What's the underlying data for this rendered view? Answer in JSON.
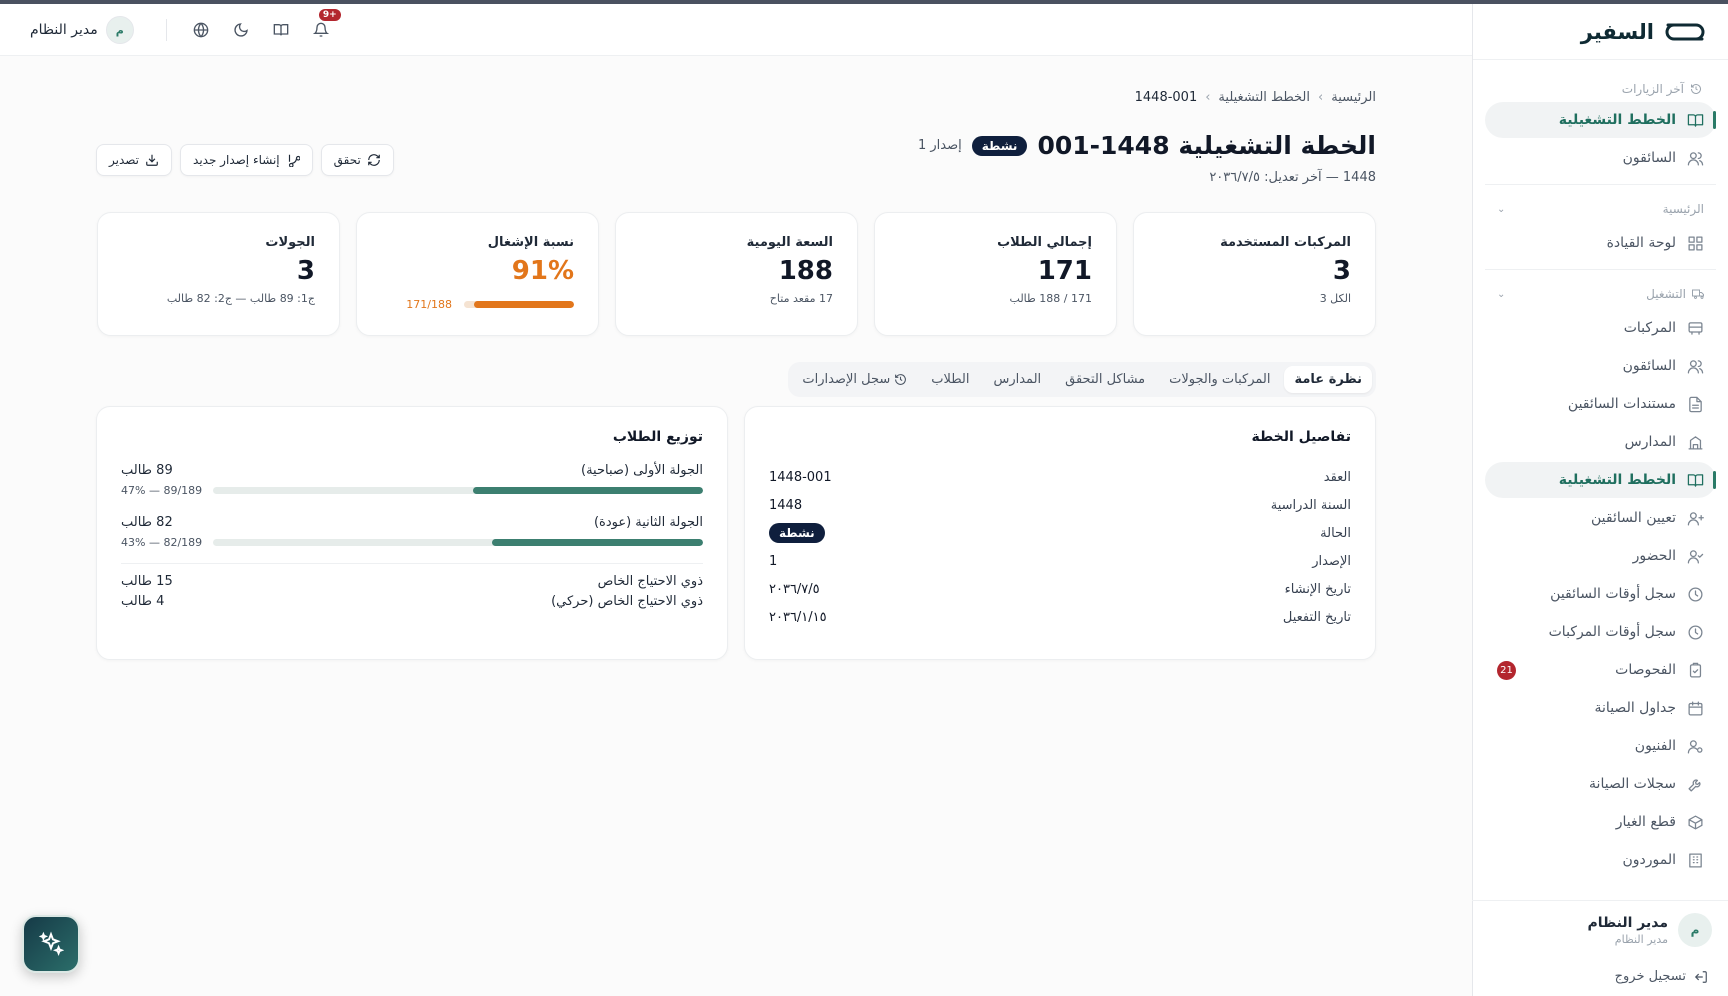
{
  "app": {
    "brand": "السفير"
  },
  "topbar": {
    "user_name": "مدير النظام",
    "user_initial": "م",
    "notif_count": "9+"
  },
  "sidebar": {
    "recent_label": "آخر الزيارات",
    "recent": [
      {
        "label": "الخطط التشغيلية",
        "icon": "book-icon",
        "active": true
      },
      {
        "label": "السائقون",
        "icon": "users-icon"
      }
    ],
    "section_home": "الرئيسية",
    "home_items": [
      {
        "label": "لوحة القيادة",
        "icon": "grid-icon"
      }
    ],
    "section_ops": "التشغيل",
    "ops_items": [
      {
        "label": "المركبات",
        "icon": "bus-icon"
      },
      {
        "label": "السائقون",
        "icon": "users-icon"
      },
      {
        "label": "مستندات السائقين",
        "icon": "file-icon"
      },
      {
        "label": "المدارس",
        "icon": "school-icon"
      },
      {
        "label": "الخطط التشغيلية",
        "icon": "book-icon",
        "active": true
      },
      {
        "label": "تعيين السائقين",
        "icon": "user-assign-icon"
      },
      {
        "label": "الحضور",
        "icon": "user-check-icon"
      },
      {
        "label": "سجل أوقات السائقين",
        "icon": "clock-icon"
      },
      {
        "label": "سجل أوقات المركبات",
        "icon": "clock-icon"
      },
      {
        "label": "الفحوصات",
        "icon": "clipboard-icon",
        "badge": "21"
      },
      {
        "label": "جداول الصيانة",
        "icon": "calendar-icon"
      },
      {
        "label": "الفنيون",
        "icon": "user-gear-icon"
      },
      {
        "label": "سجلات الصيانة",
        "icon": "wrench-icon"
      },
      {
        "label": "قطع الغيار",
        "icon": "box-icon"
      },
      {
        "label": "الموردون",
        "icon": "building-icon"
      }
    ],
    "footer": {
      "name": "مدير النظام",
      "role": "مدير النظام",
      "initial": "م",
      "logout": "تسجيل خروج"
    }
  },
  "page": {
    "breadcrumb": [
      "الرئيسية",
      "الخطط التشغيلية",
      "1448-001"
    ],
    "title": "الخطة التشغيلية 1448-001",
    "status": "نشطة",
    "version": "إصدار 1",
    "subtitle": "1448 — آخر تعديل: ٢٠٣٦/٧/٥",
    "actions": {
      "verify": "تحقق",
      "new_version": "إنشاء إصدار جديد",
      "export": "تصدير"
    }
  },
  "stats": [
    {
      "label": "المركبات المستخدمة",
      "value": "3",
      "sub": "الكل 3"
    },
    {
      "label": "إجمالي الطلاب",
      "value": "171",
      "sub": "171 / 188 طالب"
    },
    {
      "label": "السعة اليومية",
      "value": "188",
      "sub": "17 مقعد متاح"
    },
    {
      "label": "نسبة الإشغال",
      "value": "91%",
      "sub": "171/188",
      "progress": 0.91
    },
    {
      "label": "الجولات",
      "value": "3",
      "sub": "ج1: 89 طالب — ج2: 82 طالب"
    }
  ],
  "tabs": [
    "نظرة عامة",
    "المركبات والجولات",
    "مشاكل التحقق",
    "المدارس",
    "الطلاب",
    "سجل الإصدارات"
  ],
  "details": {
    "title": "تفاصيل الخطة",
    "rows": [
      {
        "k": "العقد",
        "v": "1448-001"
      },
      {
        "k": "السنة الدراسية",
        "v": "1448"
      },
      {
        "k": "الحالة",
        "v": "نشطة"
      },
      {
        "k": "الإصدار",
        "v": "1"
      },
      {
        "k": "تاريخ الإنشاء",
        "v": "٢٠٣٦/٧/٥"
      },
      {
        "k": "تاريخ التفعيل",
        "v": "٢٠٣٦/١/١٥"
      }
    ]
  },
  "distribution": {
    "title": "توزيع الطلاب",
    "rounds": [
      {
        "label": "الجولة الأولى (صباحية)",
        "count": "89 طالب",
        "pct": "89/189 — 47%",
        "fraction": 0.47
      },
      {
        "label": "الجولة الثانية (عودة)",
        "count": "82 طالب",
        "pct": "82/189 — 43%",
        "fraction": 0.43
      }
    ],
    "needs": [
      {
        "label": "ذوي الاحتياج الخاص",
        "count": "15 طالب"
      },
      {
        "label": "ذوي الاحتياج الخاص (حركي)",
        "count": "4 طالب"
      }
    ]
  },
  "colors": {
    "accent": "#2a7a67",
    "warning": "#e2761b",
    "dark_pill": "#0f1f3d",
    "badge": "#b3262e"
  }
}
